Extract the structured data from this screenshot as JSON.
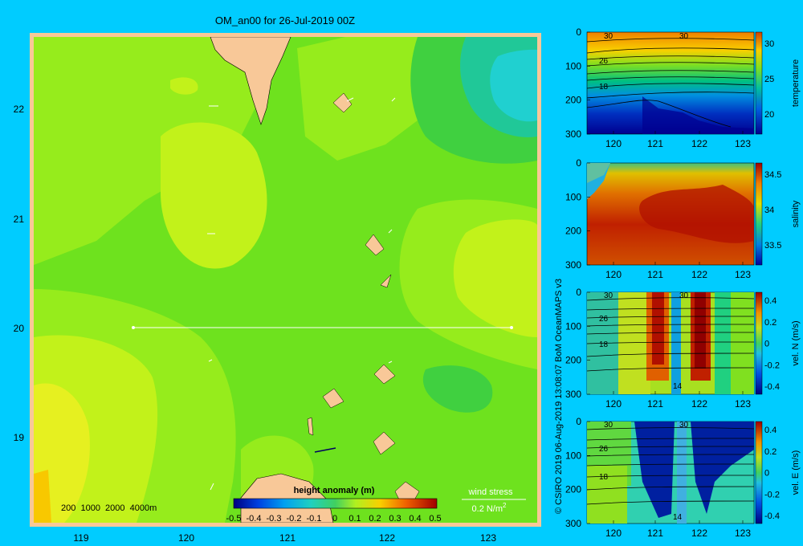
{
  "page": {
    "background": "#00ccff",
    "title": "OM_an00 for 26-Jul-2019 00Z",
    "credit": "© CSIRO 2019   06-Aug-2019 13:08:07 BoM OceanMAPS v3"
  },
  "colors": {
    "land": "#f8c898",
    "map_border": "#f8c898",
    "section_line": "#ffffff",
    "text": "#000000",
    "height_scale": [
      "#0000a0",
      "#0030d0",
      "#0070f0",
      "#00b0f8",
      "#20d8e0",
      "#00c060",
      "#20d040",
      "#60e020",
      "#a0f010",
      "#d8f020",
      "#f8e000",
      "#f8a000",
      "#f06000",
      "#d02000",
      "#a00000"
    ]
  },
  "map": {
    "x_ticks": [
      "119",
      "120",
      "121",
      "122",
      "123"
    ],
    "y_ticks": [
      "22",
      "21",
      "20",
      "19"
    ],
    "lon_range": [
      118.5,
      123.5
    ],
    "lat_range": [
      18.3,
      22.7
    ],
    "depth_legend": "200  1000  2000  4000m",
    "colorbar_title": "height anomaly (m)",
    "colorbar_ticks": [
      "-0.5",
      "-0.4",
      "-0.3",
      "-0.2",
      "-0.1",
      "0",
      "0.1",
      "0.2",
      "0.3",
      "0.4",
      "0.5"
    ],
    "wind_label": "wind stress",
    "wind_scale": "0.2 N/m",
    "wind_scale_sup": "2"
  },
  "panels": [
    {
      "label": "temperature",
      "yticks": [
        "0",
        "100",
        "200",
        "300"
      ],
      "xticks": [
        "120",
        "121",
        "122",
        "123"
      ],
      "cticks": [
        "30",
        "25",
        "20"
      ],
      "crange": "15–31",
      "contours": [
        "30",
        "26",
        "18",
        "30"
      ]
    },
    {
      "label": "salinity",
      "yticks": [
        "0",
        "100",
        "200",
        "300"
      ],
      "xticks": [
        "120",
        "121",
        "122",
        "123"
      ],
      "cticks": [
        "34.5",
        "34",
        "33.5"
      ],
      "crange": "33.4–34.9"
    },
    {
      "label": "vel. N (m/s)",
      "yticks": [
        "0",
        "100",
        "200",
        "300"
      ],
      "xticks": [
        "120",
        "121",
        "122",
        "123"
      ],
      "cticks": [
        "0.4",
        "0.2",
        "0",
        "-0.2",
        "-0.4"
      ],
      "crange": "-0.4–0.4",
      "contours": [
        "30",
        "26",
        "18",
        "14",
        "30"
      ]
    },
    {
      "label": "vel. E (m/s)",
      "yticks": [
        "0",
        "100",
        "200",
        "300"
      ],
      "xticks": [
        "120",
        "121",
        "122",
        "123"
      ],
      "cticks": [
        "0.4",
        "0.2",
        "0",
        "-0.2",
        "-0.4"
      ],
      "crange": "-0.4–0.4",
      "contours": [
        "30",
        "26",
        "18",
        "14",
        "30"
      ]
    }
  ],
  "chart_data": [
    {
      "type": "heatmap",
      "title": "OM_an00 for 26-Jul-2019 00Z",
      "variable": "height anomaly (m)",
      "xlabel": "",
      "ylabel": "",
      "x_ticks": [
        119,
        120,
        121,
        122,
        123
      ],
      "y_ticks": [
        22,
        21,
        20,
        19
      ],
      "xlim": [
        118.5,
        123.5
      ],
      "ylim": [
        18.3,
        22.7
      ],
      "color_range": [
        -0.5,
        0.5
      ],
      "section_line": {
        "lon": [
          119.5,
          123.2
        ],
        "lat": [
          20,
          20
        ]
      }
    },
    {
      "type": "heatmap",
      "variable": "temperature",
      "x_ticks": [
        120,
        121,
        122,
        123
      ],
      "y_ticks": [
        0,
        100,
        200,
        300
      ],
      "color_range": [
        15,
        31
      ]
    },
    {
      "type": "heatmap",
      "variable": "salinity",
      "x_ticks": [
        120,
        121,
        122,
        123
      ],
      "y_ticks": [
        0,
        100,
        200,
        300
      ],
      "color_range": [
        33.4,
        34.9
      ]
    },
    {
      "type": "heatmap",
      "variable": "vel. N (m/s)",
      "x_ticks": [
        120,
        121,
        122,
        123
      ],
      "y_ticks": [
        0,
        100,
        200,
        300
      ],
      "color_range": [
        -0.4,
        0.4
      ]
    },
    {
      "type": "heatmap",
      "variable": "vel. E (m/s)",
      "x_ticks": [
        120,
        121,
        122,
        123
      ],
      "y_ticks": [
        0,
        100,
        200,
        300
      ],
      "color_range": [
        -0.4,
        0.4
      ]
    }
  ]
}
